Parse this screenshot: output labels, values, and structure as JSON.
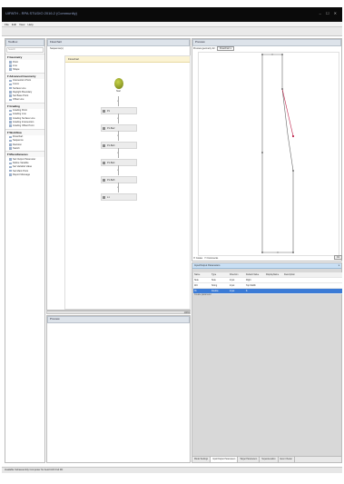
{
  "window": {
    "title": "UIPATH - RPA STUDIO 2016.2 (Community)",
    "controls": "– ☐ ✕"
  },
  "menu": [
    "File",
    "Edit",
    "View",
    "Help"
  ],
  "toolbox": {
    "title": "Toolbox",
    "search_placeholder": "Search",
    "categories": [
      {
        "name": "Geometry",
        "items": [
          "Point",
          "Line",
          "Shape"
        ]
      },
      {
        "name": "Advanced Geometry",
        "items": [
          "Intersection Point",
          "Curve",
          "Surface Line",
          "Daylight Boundary",
          "Set Base Point",
          "Offset Line"
        ]
      },
      {
        "name": "Grading",
        "items": [
          "Grading Point",
          "Grading Line",
          "Grading Surface Line",
          "Grading Intersection",
          "Grading Offset Point"
        ]
      },
      {
        "name": "Workflow",
        "items": [
          "Flowchart",
          "Sequence",
          "Decision",
          "Switch"
        ]
      },
      {
        "name": "Miscellaneous",
        "items": [
          "Set Output Parameter",
          "Define Variable",
          "Set Variable Value",
          "Set Mark Point",
          "Report Message"
        ]
      }
    ]
  },
  "designer": {
    "title": "Flowchart",
    "sequence_label": "Sequence(s)",
    "sequence_title": "Flowchart",
    "start_label": "Start",
    "activities": [
      "P1",
      "P1-Ba2",
      "P1-Ba3",
      "P1-Ba4",
      "P1-Ba5",
      "L1"
    ],
    "zoom": "100%"
  },
  "output": {
    "title": "Preview"
  },
  "preview": {
    "title": "Preview",
    "toolbar_label": "Preview geometry for:",
    "selected": "Flowchart",
    "foot_left": "Codes",
    "foot_mid": "Comments",
    "fit_button": "Fit"
  },
  "properties": {
    "title": "Input/Output Parameters",
    "columns": [
      "Name",
      "Type",
      "Direction",
      "Default Value",
      "DisplayName",
      "Description"
    ],
    "rows": [
      [
        "Side",
        "Side",
        "Input",
        "Right",
        "",
        ""
      ],
      [
        "Wd",
        "String",
        "Input",
        "Top-Width",
        "",
        ""
      ],
      [
        "Ht",
        "Double",
        "Input",
        "8",
        "",
        ""
      ]
    ],
    "add_label": "Create parameter",
    "tabs": [
      "Model Settings",
      "Input/Output Parameters",
      "Target Parameters",
      "Superelevation",
      "Event Viewer"
    ]
  },
  "status": "Available Subassembly Composer for AutoCAD Civil 3D",
  "colors": {
    "selected_row": "#3b7bd6",
    "start_node": "#98a52a",
    "accent_red": "#c0264e"
  }
}
